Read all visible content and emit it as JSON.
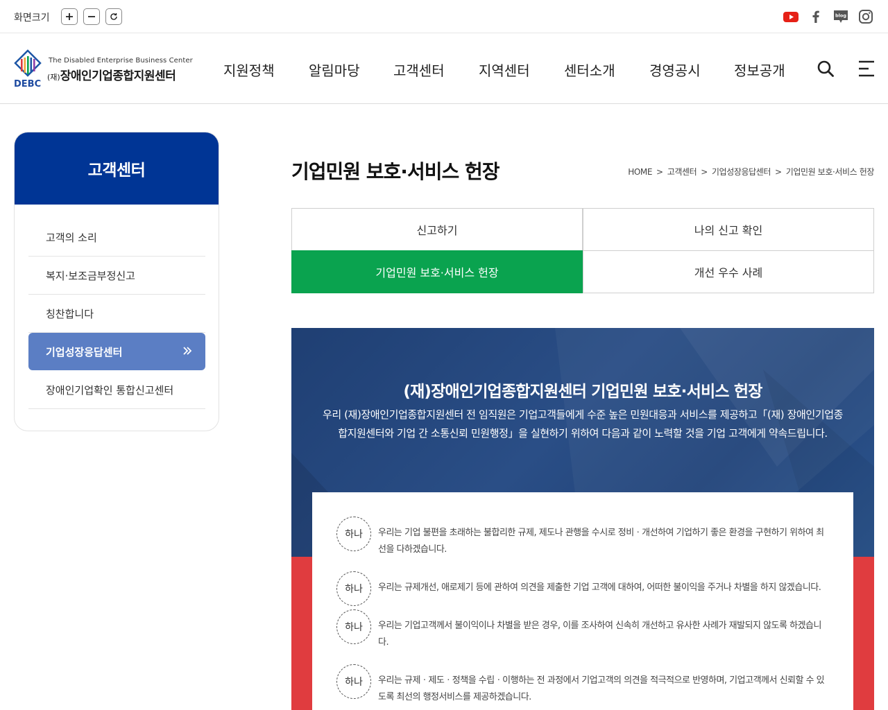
{
  "topbar": {
    "zoom_label": "화면크기",
    "zoom_in_icon": "plus-icon",
    "zoom_out_icon": "minus-icon",
    "reset_icon": "refresh-icon",
    "social": [
      {
        "name": "youtube-icon",
        "color": "#e62117"
      },
      {
        "name": "facebook-icon",
        "color": "#555555"
      },
      {
        "name": "blog-icon",
        "label": "blog",
        "color": "#555555"
      },
      {
        "name": "instagram-icon",
        "color": "#555555"
      }
    ]
  },
  "header": {
    "logo": {
      "abbr": "DEBC",
      "english": "The Disabled Enterprise Business Center",
      "korean_prefix": "(재)",
      "korean": "장애인기업종합지원센터"
    },
    "nav": [
      "지원정책",
      "알림마당",
      "고객센터",
      "지역센터",
      "센터소개",
      "경영공시",
      "정보공개"
    ],
    "search_icon": "search-icon",
    "menu_icon": "hamburger-menu-icon"
  },
  "sidebar": {
    "title": "고객센터",
    "items": [
      {
        "label": "고객의 소리",
        "active": false
      },
      {
        "label": "복지·보조금부정신고",
        "active": false
      },
      {
        "label": "칭찬합니다",
        "active": false
      },
      {
        "label": "기업성장응답센터",
        "active": true
      },
      {
        "label": "장애인기업확인 통합신고센터",
        "active": false
      }
    ]
  },
  "main": {
    "title": "기업민원 보호·서비스 헌장",
    "breadcrumb": [
      "HOME",
      "고객센터",
      "기업성장응답센터",
      "기업민원 보호·서비스 헌장"
    ],
    "breadcrumb_sep": ">",
    "tabs": [
      {
        "label": "신고하기",
        "active": false
      },
      {
        "label": "나의 신고 확인",
        "active": false
      },
      {
        "label": "기업민원 보호·서비스 헌장",
        "active": true
      },
      {
        "label": "개선 우수 사례",
        "active": false
      }
    ],
    "banner": {
      "heading": "(재)장애인기업종합지원센터 기업민원 보호·서비스 헌장",
      "intro": "우리 (재)장애인기업종합지원센터 전 임직원은 기업고객들에게 수준 높은 민원대응과 서비스를 제공하고「(재) 장애인기업종합지원센터와 기업 간 소통신뢰 민원행정」을 실현하기 위하여 다음과 같이 노력할 것을 기업 고객에게 약속드립니다."
    },
    "pledges": [
      {
        "badge": "하나",
        "text": "우리는 기업 불편을 초래하는 불합리한 규제, 제도나 관행을 수시로 정비ㆍ개선하여 기업하기 좋은 환경을 구현하기 위하여 최선을 다하겠습니다."
      },
      {
        "badge": "하나",
        "text": "우리는 규제개선, 애로제기 등에 관하여 의견을 제출한 기업 고객에 대하여, 어떠한 불이익을 주거나 차별을 하지 않겠습니다."
      },
      {
        "badge": "하나",
        "text": "우리는 기업고객께서 불이익이나 차별을 받은 경우, 이를 조사하여 신속히 개선하고 유사한 사례가 재발되지 않도록 하겠습니다."
      },
      {
        "badge": "하나",
        "text": "우리는 규제ㆍ제도ㆍ정책을 수립ㆍ이행하는 전 과정에서 기업고객의 의견을 적극적으로 반영하며, 기업고객께서 신뢰할 수 있도록 최선의 행정서비스를 제공하겠습니다."
      }
    ]
  },
  "colors": {
    "brand_blue": "#003595",
    "sidebar_active": "#5b7ec4",
    "tab_active": "#0aa34f",
    "banner_red": "#e03c3f"
  }
}
